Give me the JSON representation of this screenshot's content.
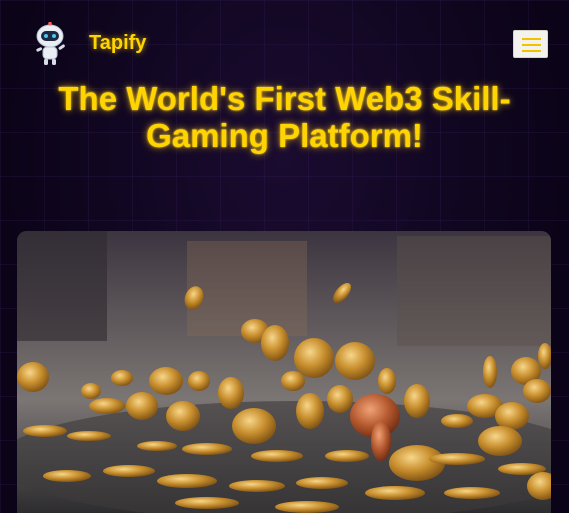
{
  "header": {
    "brand": "Tapify",
    "logo_icon": "robot-mascot-icon",
    "menu_icon": "hamburger-menu-icon"
  },
  "hero": {
    "title": "The World's First Web3 Skill-Gaming Platform!",
    "image_icon": "falling-bitcoin-coins-image"
  },
  "colors": {
    "accent": "#ffd400",
    "background": "#0c0418",
    "menu_button_bg": "#f4f2ec"
  }
}
